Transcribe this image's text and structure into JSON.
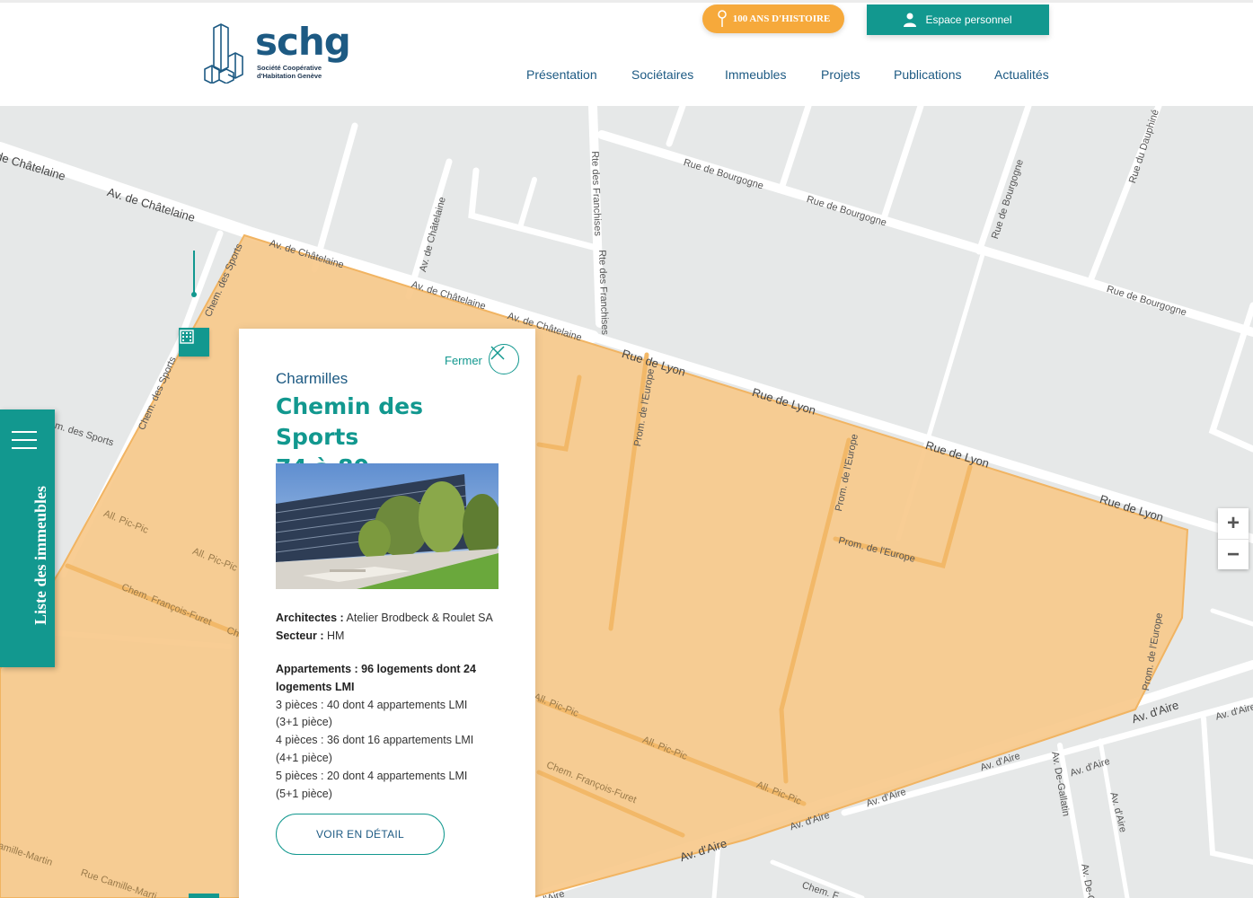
{
  "header": {
    "logo": {
      "wordmark": "schg",
      "subtitle_line1": "Société Coopérative",
      "subtitle_line2": "d'Habitation Genève"
    },
    "history_button": "100 ANS D'HISTOIRE",
    "espace_button": "Espace personnel",
    "nav": [
      "Présentation",
      "Sociétaires",
      "Immeubles",
      "Projets",
      "Publications",
      "Actualités"
    ]
  },
  "map": {
    "streets": {
      "chatelaine_1": "de Châtelaine",
      "chatelaine_2": "Av. de Châtelaine",
      "chatelaine_3": "Av. de Châtelaine",
      "chatelaine_4": "Av. de Châtelaine",
      "chatelaine_5": "Av. de Châtelaine",
      "chatelaine_vert": "Av. de Châtelaine",
      "franchises_1": "Rte des Franchises",
      "franchises_2": "Rte des Franchises",
      "bourgogne_1": "Rue de Bourgogne",
      "bourgogne_2": "Rue de Bourgogne",
      "bourgogne_3": "Rue de Bourgogne",
      "bourgogne_vert": "Rue de Bourgogne",
      "dauphine": "Rue du Dauphiné",
      "lyon_1": "Rue de Lyon",
      "lyon_2": "Rue de Lyon",
      "lyon_3": "Rue de Lyon",
      "lyon_4": "Rue de Lyon",
      "europe_1": "Prom. de l'Europe",
      "europe_2": "Prom. de l'Europe",
      "europe_3": "Prom. de l'Europe",
      "europe_4": "Prom. de l'Europe",
      "sports_1": "Chem. des Sports",
      "sports_2": "Chem. des Sports",
      "sports_3": "m. des Sports",
      "picpic_1": "All. Pic-Pic",
      "picpic_2": "All. Pic-Pic",
      "picpic_3": "All. Pic-Pic",
      "picpic_4": "All. Pic-Pic",
      "picpic_5": "All. Pic-Pic",
      "furet_1": "Chem. François-Furet",
      "furet_2": "Chem. François-Furet",
      "furet_3": "Ch",
      "aire_1": "Av. d'Aire",
      "aire_2": "Av. d'Aire",
      "aire_3": "Av. d'Aire",
      "aire_4": "Av. d'Aire",
      "aire_5": "Av. d'Aire",
      "aire_6": "Av. d'Aire",
      "aire_7": "Av. d'Aire",
      "aire_8": "Av. d'Aire",
      "aire_9": "d'Aire",
      "gallatin_1": "Av. De-Gallatin",
      "gallatin_2": "Av. De-G",
      "camille_1": "amille-Martin",
      "camille_2": "Rue Camille-Marti",
      "chem_bottom": "Chem. F"
    },
    "zoom_in": "+",
    "zoom_out": "−",
    "list_tab": "Liste des immeubles"
  },
  "popup": {
    "close_label": "Fermer",
    "quarter": "Charmilles",
    "title_line1": "Chemin des Sports",
    "title_line2": "74 à 80",
    "architects_label": "Architectes :",
    "architects_value": "Atelier Brodbeck & Roulet SA",
    "sector_label": "Secteur :",
    "sector_value": "HM",
    "apartments_head": "Appartements : 96 logements dont 24 logements LMI",
    "apt_1a": "3 pièces : 40 dont 4 appartements LMI",
    "apt_1b": "(3+1 pièce)",
    "apt_2a": "4 pièces : 36 dont 16 appartements LMI",
    "apt_2b": "(4+1 pièce)",
    "apt_3a": "5 pièces : 20 dont 4 appartements LMI",
    "apt_3b": "(5+1 pièce)",
    "detail_button": "VOIR EN DÉTAIL"
  },
  "colors": {
    "accent": "#12988f",
    "brand_blue": "#1d5a83",
    "history_orange": "#f6a93b",
    "zone_fill": "#f7c98b"
  }
}
